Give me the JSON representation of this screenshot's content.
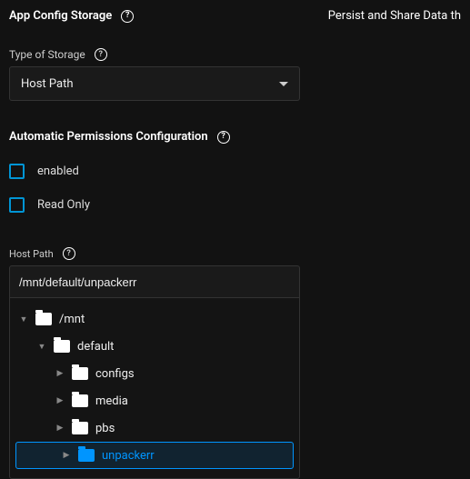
{
  "header": {
    "title": "App Config Storage",
    "right_text": "Persist and Share Data th"
  },
  "storage_type": {
    "label": "Type of Storage",
    "value": "Host Path"
  },
  "permissions": {
    "label": "Automatic Permissions Configuration",
    "enabled_label": "enabled",
    "readonly_label": "Read Only"
  },
  "host_path": {
    "label": "Host Path",
    "value": "/mnt/default/unpackerr"
  },
  "tree": {
    "root": {
      "label": "/mnt",
      "expanded": true
    },
    "child": {
      "label": "default",
      "expanded": true
    },
    "items": [
      {
        "label": "configs"
      },
      {
        "label": "media"
      },
      {
        "label": "pbs"
      },
      {
        "label": "unpackerr",
        "selected": true
      }
    ]
  }
}
